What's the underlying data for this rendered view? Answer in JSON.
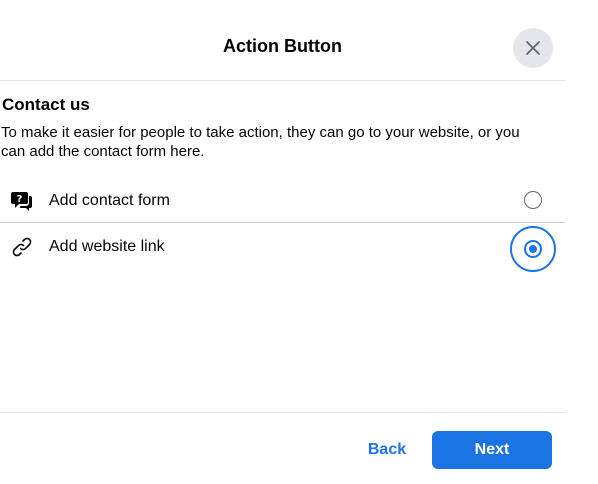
{
  "dialog": {
    "title": "Action Button",
    "close_icon": "close-icon"
  },
  "section": {
    "title": "Contact us",
    "description": "To make it easier for people to take action, they can go to your website, or you can add the contact form here."
  },
  "options": [
    {
      "label": "Add contact form",
      "icon": "contact-form-icon",
      "selected": false
    },
    {
      "label": "Add website link",
      "icon": "link-icon",
      "selected": true
    }
  ],
  "footer": {
    "back_label": "Back",
    "next_label": "Next"
  },
  "colors": {
    "accent": "#1b74e4",
    "close_bg": "#e4e6eb",
    "divider": "#e4e6eb"
  }
}
